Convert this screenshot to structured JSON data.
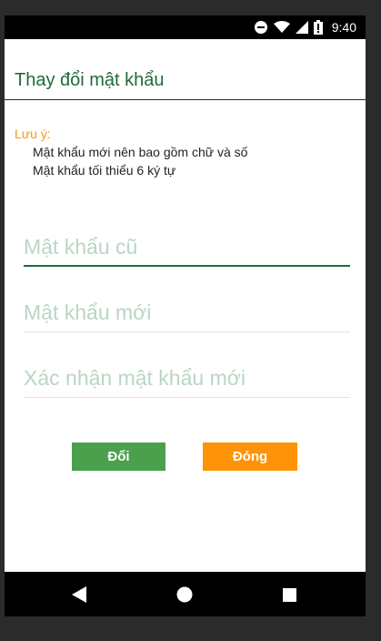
{
  "status_bar": {
    "time": "9:40",
    "icons": [
      "do-not-disturb-icon",
      "wifi-icon",
      "signal-icon",
      "battery-icon"
    ]
  },
  "dialog": {
    "title": "Thay đổi mật khẩu",
    "note": {
      "heading": "Lưu ý:",
      "lines": [
        "Mật khẩu mới nên bao gồm chữ và số",
        "Mật khẩu tối thiểu 6 ký tự"
      ]
    },
    "fields": [
      {
        "placeholder": "Mật khẩu cũ",
        "value": ""
      },
      {
        "placeholder": "Mật khẩu mới",
        "value": ""
      },
      {
        "placeholder": "Xác nhận mật khẩu mới",
        "value": ""
      }
    ],
    "buttons": {
      "change": "Đổi",
      "close": "Đóng"
    }
  },
  "nav_bar": {
    "icons": [
      "back-icon",
      "home-icon",
      "recents-icon"
    ]
  },
  "colors": {
    "title": "#1f6b3a",
    "note_heading": "#f39a12",
    "change_button": "#4aa04d",
    "close_button": "#ff9307"
  }
}
